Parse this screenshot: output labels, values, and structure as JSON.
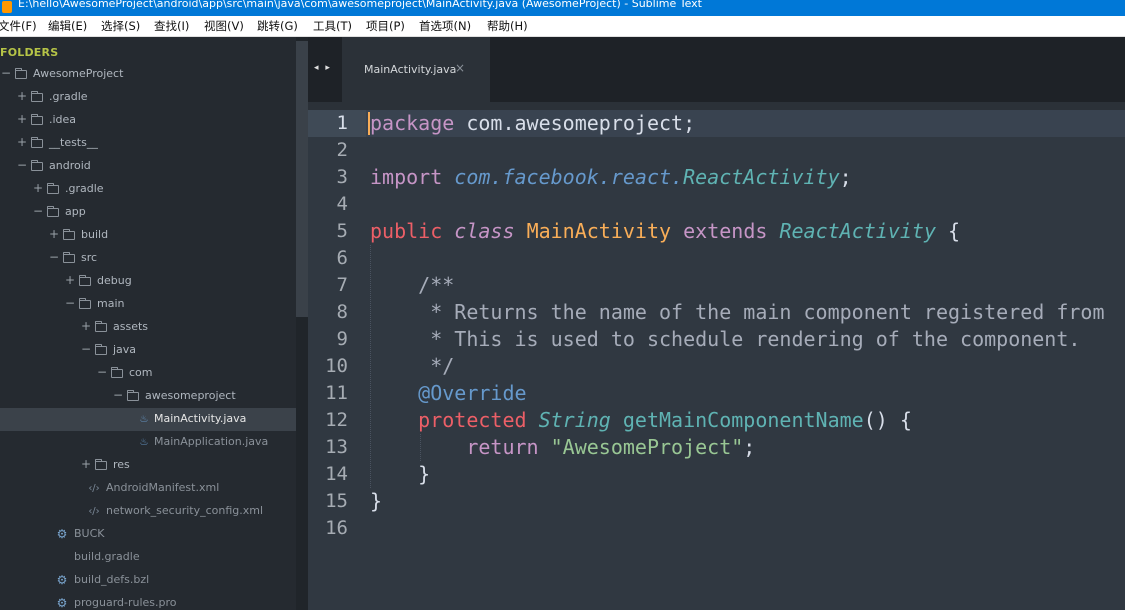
{
  "window": {
    "title": "E:\\hello\\AwesomeProject\\android\\app\\src\\main\\java\\com\\awesomeproject\\MainActivity.java (AwesomeProject) - Sublime Text"
  },
  "menu": [
    "文件(F)",
    "编辑(E)",
    "选择(S)",
    "查找(I)",
    "视图(V)",
    "跳转(G)",
    "工具(T)",
    "项目(P)",
    "首选项(N)",
    "帮助(H)"
  ],
  "sidebar": {
    "header": "FOLDERS",
    "items": [
      {
        "label": "AwesomeProject",
        "depth": 0,
        "type": "folder",
        "state": "open"
      },
      {
        "label": ".gradle",
        "depth": 1,
        "type": "folder",
        "state": "closed"
      },
      {
        "label": ".idea",
        "depth": 1,
        "type": "folder",
        "state": "closed"
      },
      {
        "label": "__tests__",
        "depth": 1,
        "type": "folder",
        "state": "closed"
      },
      {
        "label": "android",
        "depth": 1,
        "type": "folder",
        "state": "open"
      },
      {
        "label": ".gradle",
        "depth": 2,
        "type": "folder",
        "state": "closed"
      },
      {
        "label": "app",
        "depth": 2,
        "type": "folder",
        "state": "open"
      },
      {
        "label": "build",
        "depth": 3,
        "type": "folder",
        "state": "closed"
      },
      {
        "label": "src",
        "depth": 3,
        "type": "folder",
        "state": "open"
      },
      {
        "label": "debug",
        "depth": 4,
        "type": "folder",
        "state": "closed"
      },
      {
        "label": "main",
        "depth": 4,
        "type": "folder",
        "state": "open"
      },
      {
        "label": "assets",
        "depth": 5,
        "type": "folder",
        "state": "closed"
      },
      {
        "label": "java",
        "depth": 5,
        "type": "folder",
        "state": "open"
      },
      {
        "label": "com",
        "depth": 6,
        "type": "folder",
        "state": "open"
      },
      {
        "label": "awesomeproject",
        "depth": 7,
        "type": "folder",
        "state": "open"
      },
      {
        "label": "MainActivity.java",
        "depth": 8,
        "type": "java",
        "selected": true
      },
      {
        "label": "MainApplication.java",
        "depth": 8,
        "type": "java"
      },
      {
        "label": "res",
        "depth": 5,
        "type": "folder",
        "state": "closed"
      },
      {
        "label": "AndroidManifest.xml",
        "depth": 5,
        "type": "xml"
      },
      {
        "label": "network_security_config.xml",
        "depth": 5,
        "type": "xml"
      },
      {
        "label": "BUCK",
        "depth": 3,
        "type": "gear"
      },
      {
        "label": "build.gradle",
        "depth": 3,
        "type": "file"
      },
      {
        "label": "build_defs.bzl",
        "depth": 3,
        "type": "gear"
      },
      {
        "label": "proguard-rules.pro",
        "depth": 3,
        "type": "gear"
      }
    ]
  },
  "tabs": {
    "nav": "◂ ▸",
    "active": {
      "label": "MainActivity.java",
      "close": "×"
    }
  },
  "editor": {
    "current_line": 1,
    "lines": [
      [
        [
          "kw",
          "package"
        ],
        [
          "pun",
          " com.awesomeproject;"
        ]
      ],
      [],
      [
        [
          "kw",
          "import"
        ],
        [
          "pun",
          " "
        ],
        [
          "pkg",
          "com.facebook.react."
        ],
        [
          "ty",
          "ReactActivity"
        ],
        [
          "pun",
          ";"
        ]
      ],
      [],
      [
        [
          "kw-red",
          "public"
        ],
        [
          "pun",
          " "
        ],
        [
          "kw-it",
          "class"
        ],
        [
          "pun",
          " "
        ],
        [
          "cls",
          "MainActivity"
        ],
        [
          "pun",
          " "
        ],
        [
          "kw",
          "extends"
        ],
        [
          "pun",
          " "
        ],
        [
          "ty",
          "ReactActivity"
        ],
        [
          "pun",
          " {"
        ]
      ],
      [],
      [
        [
          "pun",
          "    "
        ],
        [
          "cm",
          "/**"
        ]
      ],
      [
        [
          "pun",
          "     "
        ],
        [
          "cm",
          "* Returns the name of the main component registered from"
        ]
      ],
      [
        [
          "pun",
          "     "
        ],
        [
          "cm",
          "* This is used to schedule rendering of the component."
        ]
      ],
      [
        [
          "pun",
          "     "
        ],
        [
          "cm",
          "*/"
        ]
      ],
      [
        [
          "pun",
          "    "
        ],
        [
          "ann",
          "@Override"
        ]
      ],
      [
        [
          "pun",
          "    "
        ],
        [
          "kw-red",
          "protected"
        ],
        [
          "pun",
          " "
        ],
        [
          "ty",
          "String"
        ],
        [
          "pun",
          " "
        ],
        [
          "fn",
          "getMainComponentName"
        ],
        [
          "pun",
          "() {"
        ]
      ],
      [
        [
          "pun",
          "        "
        ],
        [
          "kw",
          "return"
        ],
        [
          "pun",
          " "
        ],
        [
          "str",
          "\"AwesomeProject\""
        ],
        [
          "pun",
          ";"
        ]
      ],
      [
        [
          "pun",
          "    }"
        ]
      ],
      [
        [
          "pun",
          "}"
        ]
      ],
      []
    ]
  },
  "colors": {
    "background": "#303841",
    "sidebar": "#252a30",
    "accent": "#f9ae58",
    "titlebar": "#0078d7"
  }
}
